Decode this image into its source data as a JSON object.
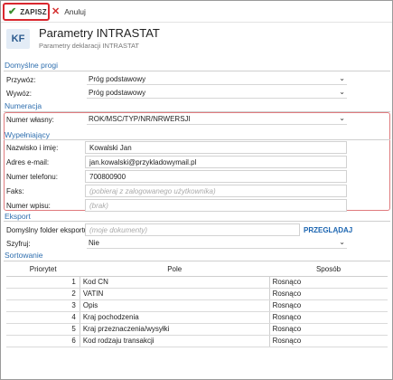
{
  "toolbar": {
    "save_label": "ZAPISZ",
    "cancel_label": "Anuluj"
  },
  "header": {
    "logo": "KF",
    "title": "Parametry INTRASTAT",
    "subtitle": "Parametry deklaracji INTRASTAT"
  },
  "sections": {
    "defaults": "Domyślne progi",
    "numbering": "Numeracja",
    "filler": "Wypełniający",
    "export": "Eksport",
    "sorting": "Sortowanie"
  },
  "defaults": {
    "import_label": "Przywóz:",
    "import_value": "Próg podstawowy",
    "export_label": "Wywóz:",
    "export_value": "Próg podstawowy"
  },
  "numbering": {
    "own_label": "Numer własny:",
    "own_value": "ROK/MSC/TYP/NR/NRWERSJI"
  },
  "filler": {
    "name_label": "Nazwisko i imię:",
    "name_value": "Kowalski Jan",
    "email_label": "Adres e-mail:",
    "email_value": "jan.kowalski@przykladowymail.pl",
    "phone_label": "Numer telefonu:",
    "phone_value": "700800900",
    "fax_label": "Faks:",
    "fax_placeholder": "(pobieraj z zalogowanego użytkownika)",
    "entry_label": "Numer wpisu:",
    "entry_placeholder": "(brak)"
  },
  "export_cfg": {
    "folder_label": "Domyślny folder eksportu:",
    "folder_placeholder": "(moje dokumenty)",
    "browse_label": "PRZEGLĄDAJ",
    "encrypt_label": "Szyfruj:",
    "encrypt_value": "Nie"
  },
  "sorting": {
    "headers": [
      "Priorytet",
      "Pole",
      "Sposób"
    ],
    "rows": [
      {
        "priority": "1",
        "field": "Kod CN",
        "method": "Rosnąco"
      },
      {
        "priority": "2",
        "field": "VATIN",
        "method": "Rosnąco"
      },
      {
        "priority": "3",
        "field": "Opis",
        "method": "Rosnąco"
      },
      {
        "priority": "4",
        "field": "Kraj pochodzenia",
        "method": "Rosnąco"
      },
      {
        "priority": "5",
        "field": "Kraj przeznaczenia/wysyłki",
        "method": "Rosnąco"
      },
      {
        "priority": "6",
        "field": "Kod rodzaju transakcji",
        "method": "Rosnąco"
      }
    ]
  },
  "icons": {
    "save": "checkmark-icon",
    "cancel": "close-icon",
    "dropdown": "chevron-down-icon"
  },
  "colors": {
    "accent": "#2f6faf",
    "highlight": "#d9272e",
    "save_icon": "#3a8d2e",
    "cancel_icon": "#d32f2f"
  }
}
